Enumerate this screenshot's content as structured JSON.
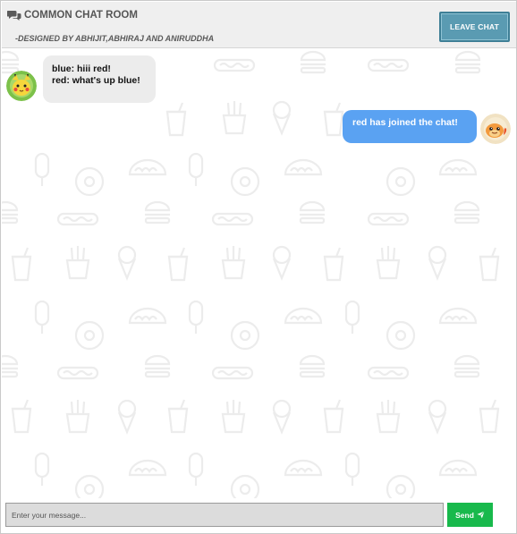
{
  "header": {
    "title": "COMMON CHAT ROOM",
    "title_icon": "comments-icon",
    "subtitle": "-DESIGNED BY ABHIJIT,ABHIRAJ AND ANIRUDDHA",
    "leave_label": "LEAVE CHAT"
  },
  "messages": [
    {
      "direction": "incoming",
      "avatar": "pikachu-avatar",
      "lines": [
        "blue: hiii red!",
        "red: what's up blue!"
      ]
    },
    {
      "direction": "outgoing",
      "avatar": "charmander-avatar",
      "lines": [
        "red has joined the chat!"
      ]
    }
  ],
  "composer": {
    "placeholder": "Enter your message...",
    "value": "",
    "send_label": "Send",
    "send_icon": "paper-plane-icon"
  },
  "colors": {
    "header_bg": "#efefef",
    "leave_button": "#5a9bb2",
    "incoming_bubble": "#ececec",
    "outgoing_bubble": "#5aa2f2",
    "send_button": "#18b94c"
  }
}
